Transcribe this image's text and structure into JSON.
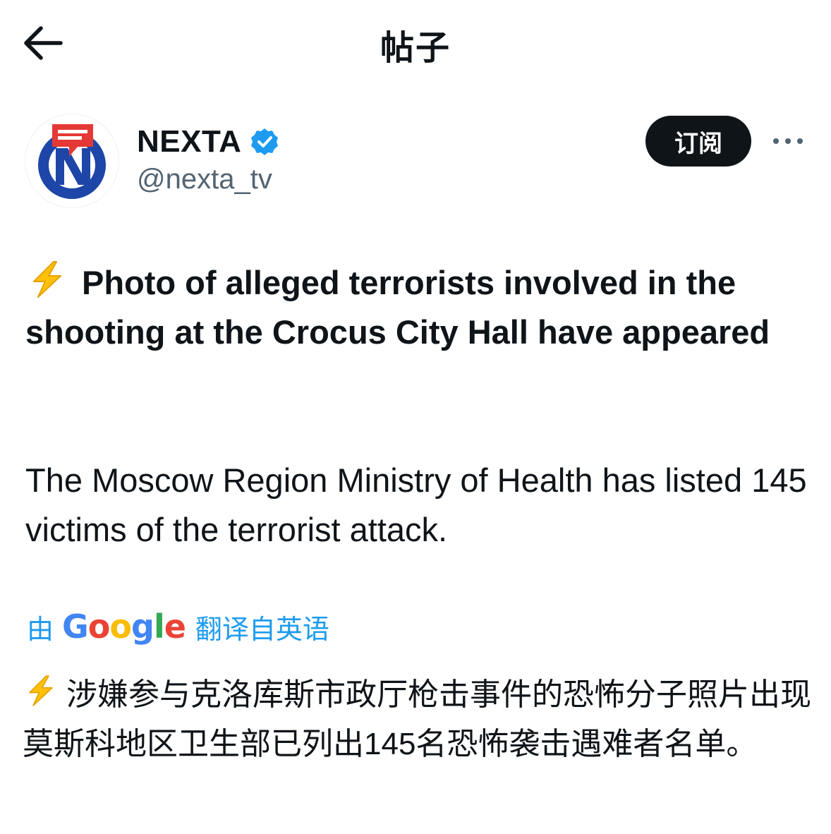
{
  "topbar": {
    "back_icon": "arrow-left-icon",
    "title": "帖子"
  },
  "author": {
    "avatar_icon": "nexta-logo-icon",
    "display_name": "NEXTA",
    "verified_icon": "verified-badge-icon",
    "handle": "@nexta_tv",
    "subscribe_label": "订阅",
    "more_icon": "more-horizontal-icon"
  },
  "tweet": {
    "headline_emoji": "lightning-emoji",
    "headline": "Photo of alleged terrorists involved in the shooting at the Crocus City Hall have appeared",
    "body": "The Moscow Region Ministry of Health has listed 145 victims of the terrorist attack."
  },
  "translation": {
    "prefix": "由",
    "brand": "Google",
    "suffix": "翻译自英语",
    "line1": "涉嫌参与克洛库斯市政厅枪击事件的恐怖分子照片出现",
    "line2": "莫斯科地区卫生部已列出145名恐怖袭击遇难者名单。"
  },
  "colors": {
    "text": "#0f1419",
    "secondary": "#536471",
    "link": "#1d9bf0",
    "verified": "#1d9bf0",
    "button_bg": "#0f1419",
    "nexta_red": "#e53935",
    "nexta_blue": "#1e46a8"
  }
}
